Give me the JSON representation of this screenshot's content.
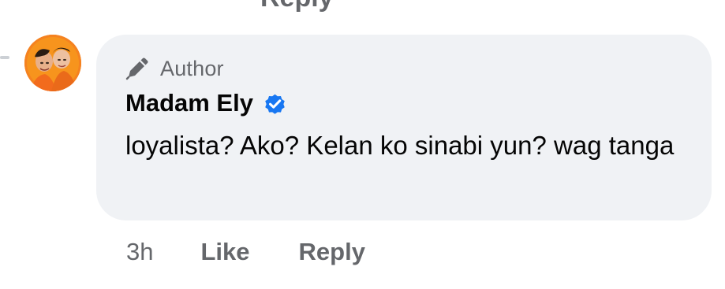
{
  "header": {
    "cut_off_text": "Reply"
  },
  "comment": {
    "badge_label": "Author",
    "author_name": "Madam Ely",
    "text": "loyalista? Ako? Kelan ko sinabi yun? wag tanga",
    "timestamp": "3h",
    "like_label": "Like",
    "reply_label": "Reply",
    "verified": true
  },
  "colors": {
    "bubble_bg": "#f0f2f5",
    "secondary_text": "#65676b",
    "primary_text": "#050505",
    "verified_blue": "#1877f2",
    "avatar_orange": "#f58220"
  },
  "icons": {
    "author_badge": "pen-icon",
    "verified": "verified-icon"
  }
}
